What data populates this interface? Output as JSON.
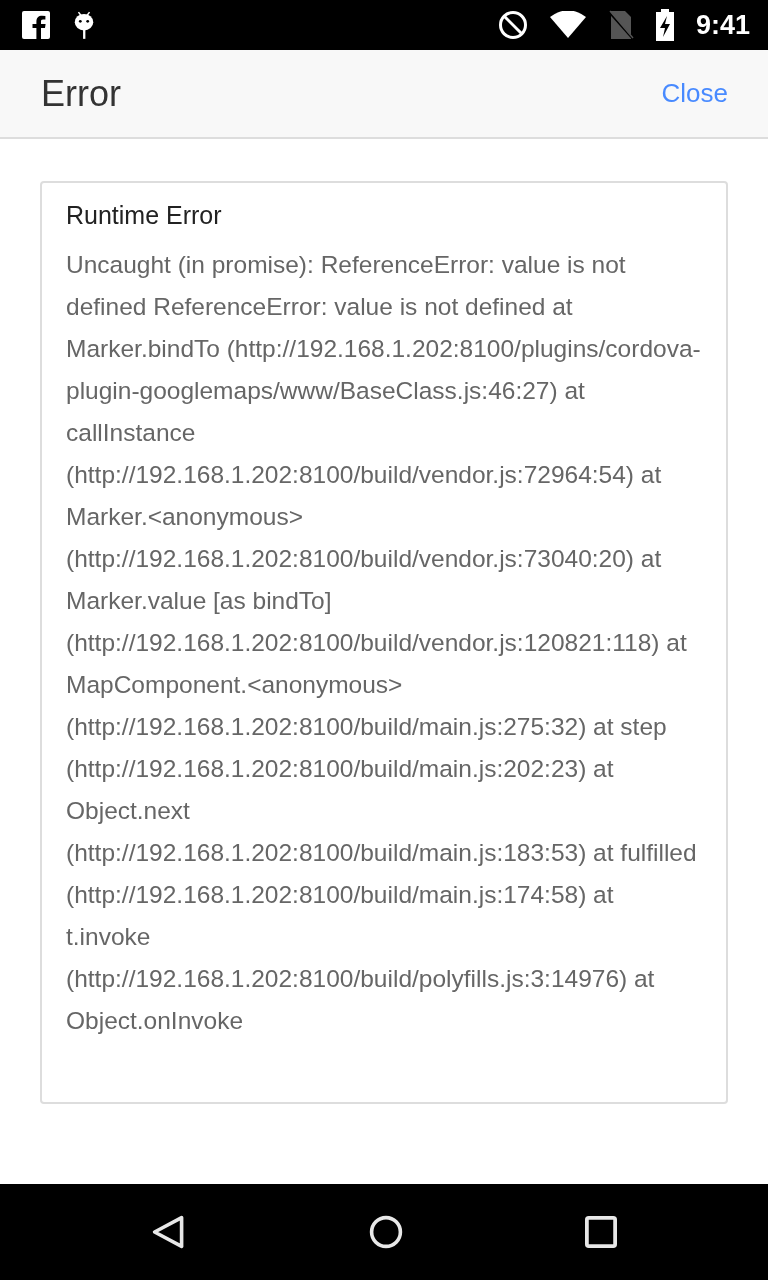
{
  "status_bar": {
    "time": "9:41"
  },
  "header": {
    "title": "Error",
    "close_label": "Close"
  },
  "error": {
    "title": "Runtime Error",
    "message": "Uncaught (in promise): ReferenceError: value is not defined ReferenceError: value is not defined at Marker.bindTo (http://192.168.1.202:8100/plugins/cordova-plugin-googlemaps/www/BaseClass.js:46:27) at callInstance (http://192.168.1.202:8100/build/vendor.js:72964:54) at Marker.<anonymous> (http://192.168.1.202:8100/build/vendor.js:73040:20) at Marker.value [as bindTo] (http://192.168.1.202:8100/build/vendor.js:120821:118) at MapComponent.<anonymous> (http://192.168.1.202:8100/build/main.js:275:32) at step (http://192.168.1.202:8100/build/main.js:202:23) at Object.next (http://192.168.1.202:8100/build/main.js:183:53) at fulfilled (http://192.168.1.202:8100/build/main.js:174:58) at t.invoke (http://192.168.1.202:8100/build/polyfills.js:3:14976) at Object.onInvoke"
  }
}
